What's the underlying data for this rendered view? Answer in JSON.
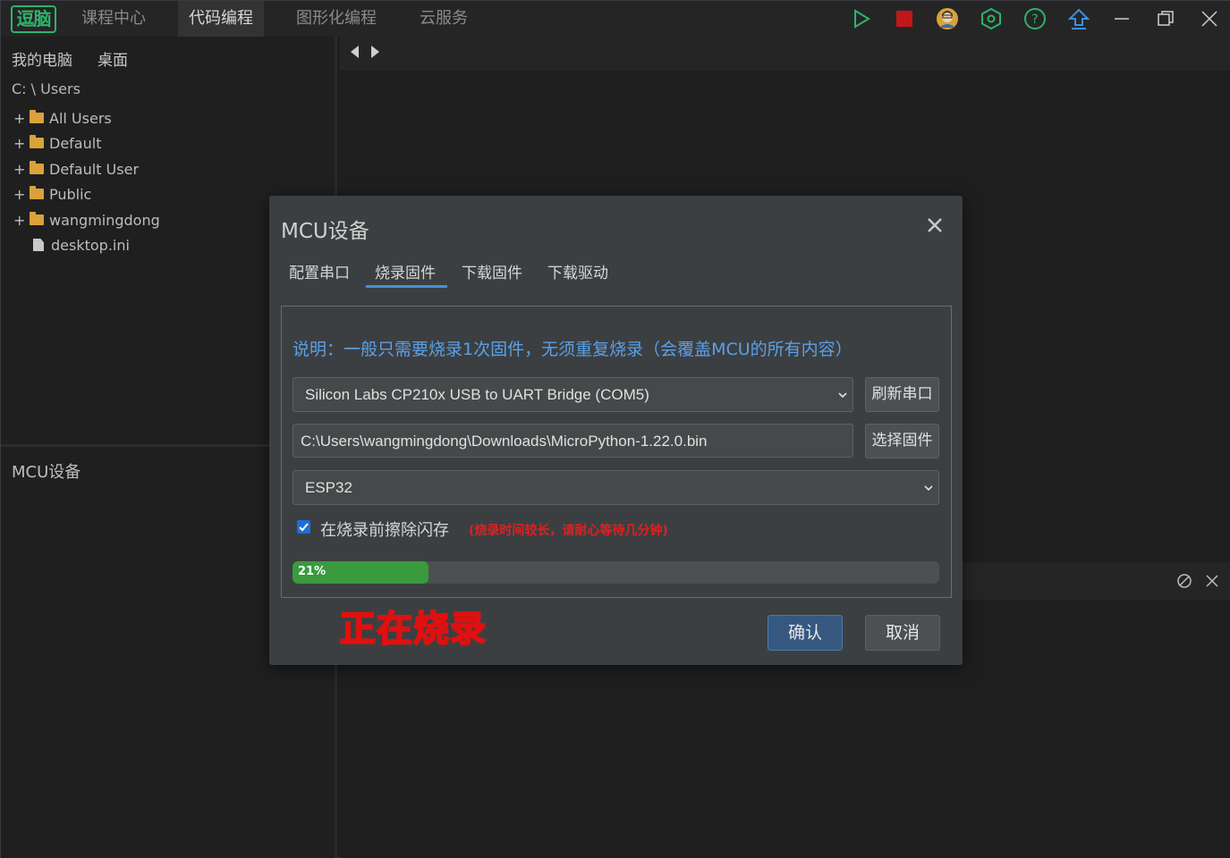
{
  "app": {
    "logo_text": "逗脑",
    "nav": [
      "课程中心",
      "代码编程",
      "图形化编程",
      "云服务"
    ],
    "active_nav": "代码编程",
    "toolbar_icons": [
      "run-icon",
      "stop-icon",
      "avatar-icon",
      "settings-hex-icon",
      "help-icon",
      "upload-icon",
      "minimize-icon",
      "restore-icon",
      "close-icon"
    ],
    "accent_color": "#2fb36a"
  },
  "sidebar": {
    "tabs": [
      "我的电脑",
      "桌面"
    ],
    "path": "C: \\ Users",
    "items": [
      {
        "label": "All Users",
        "type": "folder"
      },
      {
        "label": "Default",
        "type": "folder"
      },
      {
        "label": "Default User",
        "type": "folder"
      },
      {
        "label": "Public",
        "type": "folder"
      },
      {
        "label": "wangmingdong",
        "type": "folder"
      },
      {
        "label": "desktop.ini",
        "type": "file"
      }
    ],
    "mcu_title": "MCU设备"
  },
  "dialog": {
    "title": "MCU设备",
    "tabs": [
      "配置串口",
      "烧录固件",
      "下载固件",
      "下载驱动"
    ],
    "active_tab": "烧录固件",
    "note": "说明：一般只需要烧录1次固件，无须重复烧录（会覆盖MCU的所有内容）",
    "port_value": "Silicon Labs CP210x USB to UART Bridge (COM5)",
    "refresh_label": "刷新串口",
    "firmware_path": "C:\\Users\\wangmingdong\\Downloads\\MicroPython-1.22.0.bin",
    "select_firmware_label": "选择固件",
    "board_value": "ESP32",
    "erase_label": "在烧录前擦除闪存",
    "erase_warning": "(烧录时间较长，请耐心等待几分钟)",
    "erase_checked": true,
    "progress_percent": 21,
    "progress_text": "21%",
    "status_overlay": "正在烧录",
    "confirm_label": "确认",
    "cancel_label": "取消"
  }
}
